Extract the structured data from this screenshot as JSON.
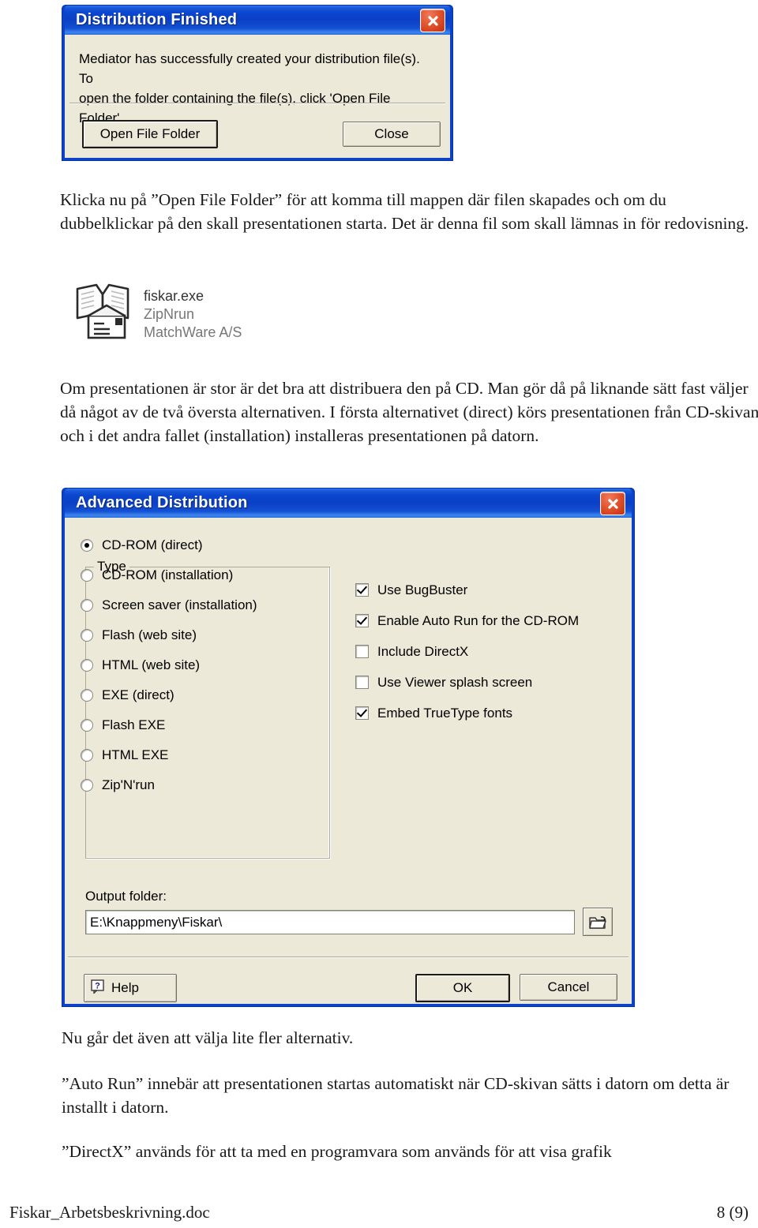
{
  "document": {
    "paragraphs": {
      "p1": "Klicka nu på ”Open File Folder” för att komma till mappen där filen skapades och om du dubbelklickar på den skall presentationen starta. Det är denna fil som skall lämnas in för redovisning.",
      "p2": "Om presentationen är stor är det bra att distribuera den på CD. Man gör då på liknande sätt fast väljer då något av de två översta alternativen. I första alternativet (direct) körs presentationen från CD-skivan och i det andra fallet (installation) installeras presentationen på datorn.",
      "p3": "Nu går det även att välja lite fler alternativ.",
      "p4": "”Auto Run” innebär att presentationen startas automatiskt när CD-skivan sätts i datorn om detta är installt i datorn.",
      "p5": "”DirectX” används för att ta med en programvara som används för att visa grafik"
    },
    "footer": {
      "filename": "Fiskar_Arbetsbeskrivning.doc",
      "page": "8 (9)"
    }
  },
  "dialog_finished": {
    "title": "Distribution Finished",
    "close_icon": "close-icon",
    "message": "Mediator has successfully created your distribution file(s). To\nopen the folder containing the file(s), click 'Open File Folder'.",
    "buttons": {
      "open_file_folder": "Open File Folder",
      "close": "Close"
    }
  },
  "file_item": {
    "icon": "book-envelope-icon",
    "name": "fiskar.exe",
    "product": "ZipNrun",
    "vendor": "MatchWare A/S"
  },
  "dialog_advanced": {
    "title": "Advanced Distribution",
    "close_icon": "close-icon",
    "type_group": {
      "legend": "Type",
      "selected": "CD-ROM (direct)",
      "options": [
        {
          "label": "CD-ROM (direct)",
          "checked": true
        },
        {
          "label": "CD-ROM (installation)",
          "checked": false
        },
        {
          "label": "Screen saver (installation)",
          "checked": false
        },
        {
          "label": "Flash (web site)",
          "checked": false
        },
        {
          "label": "HTML (web site)",
          "checked": false
        },
        {
          "label": "EXE (direct)",
          "checked": false
        },
        {
          "label": "Flash EXE",
          "checked": false
        },
        {
          "label": "HTML EXE",
          "checked": false
        },
        {
          "label": "Zip'N'run",
          "checked": false
        }
      ]
    },
    "checkboxes": [
      {
        "label": "Use BugBuster",
        "checked": true
      },
      {
        "label": "Enable Auto Run for the CD-ROM",
        "checked": true
      },
      {
        "label": "Include DirectX",
        "checked": false
      },
      {
        "label": "Use Viewer splash screen",
        "checked": false
      },
      {
        "label": "Embed TrueType fonts",
        "checked": true
      }
    ],
    "output": {
      "label": "Output folder:",
      "value": "E:\\Knappmeny\\Fiskar\\",
      "browse_icon": "folder-browse-icon"
    },
    "buttons": {
      "help": "Help",
      "help_icon": "question-help-icon",
      "ok": "OK",
      "cancel": "Cancel"
    }
  },
  "colors": {
    "titlebar_blue": "#0a42c8",
    "dialog_face": "#ece9d8",
    "close_red": "#c22f10",
    "page_bg": "#ffffff"
  }
}
